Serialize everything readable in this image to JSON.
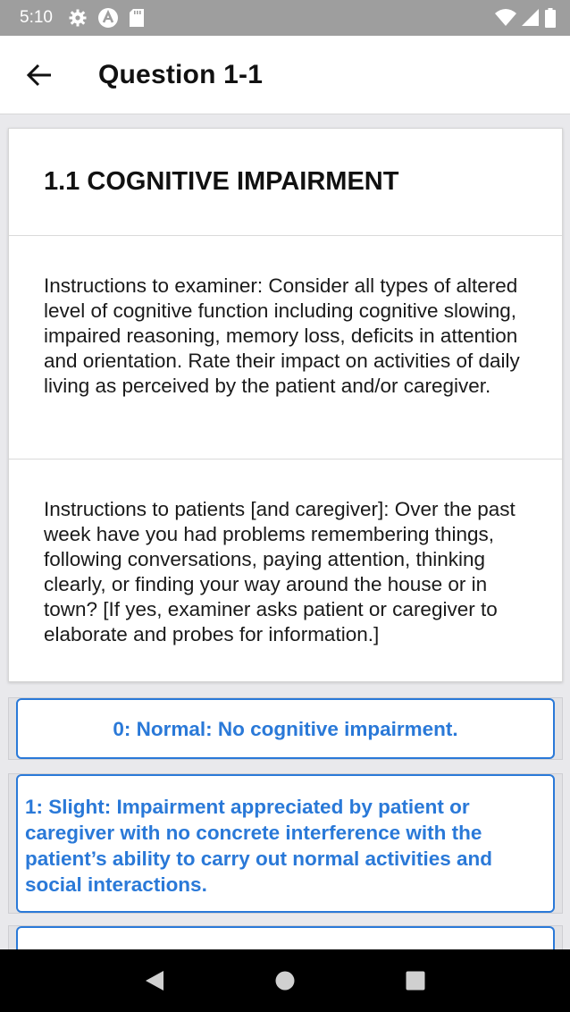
{
  "status_bar": {
    "time": "5:10",
    "icons_left": [
      "gear-icon",
      "a-icon",
      "sd-card-icon"
    ],
    "icons_right": [
      "wifi-icon",
      "signal-icon",
      "battery-icon"
    ]
  },
  "app_bar": {
    "title": "Question 1-1",
    "back_icon": "arrow-left-icon"
  },
  "card": {
    "title": "1.1 COGNITIVE IMPAIRMENT",
    "examiner_instructions": "Instructions to examiner: Consider all types of altered level of cognitive function including cognitive slowing, impaired reasoning, memory loss, deficits in attention and orientation. Rate their impact on activities of daily living as perceived by the patient and/or caregiver.",
    "patient_instructions": "Instructions to patients [and caregiver]: Over the past week have you had problems remembering things, following conversations, paying attention, thinking clearly, or finding your way around the house or in town? [If yes, examiner asks patient or caregiver to elaborate and probes for information.]"
  },
  "options": [
    {
      "label": "0: Normal: No cognitive impairment."
    },
    {
      "label": "1: Slight: Impairment appreciated by patient or caregiver with no concrete interference with the patient’s ability to carry out normal activities and social interactions."
    }
  ],
  "colors": {
    "accent": "#2a79d8",
    "status_bar": "#9e9e9e",
    "background": "#e9e9ec"
  },
  "nav_bar": {
    "icons": [
      "back-triangle-icon",
      "home-circle-icon",
      "recents-square-icon"
    ]
  }
}
